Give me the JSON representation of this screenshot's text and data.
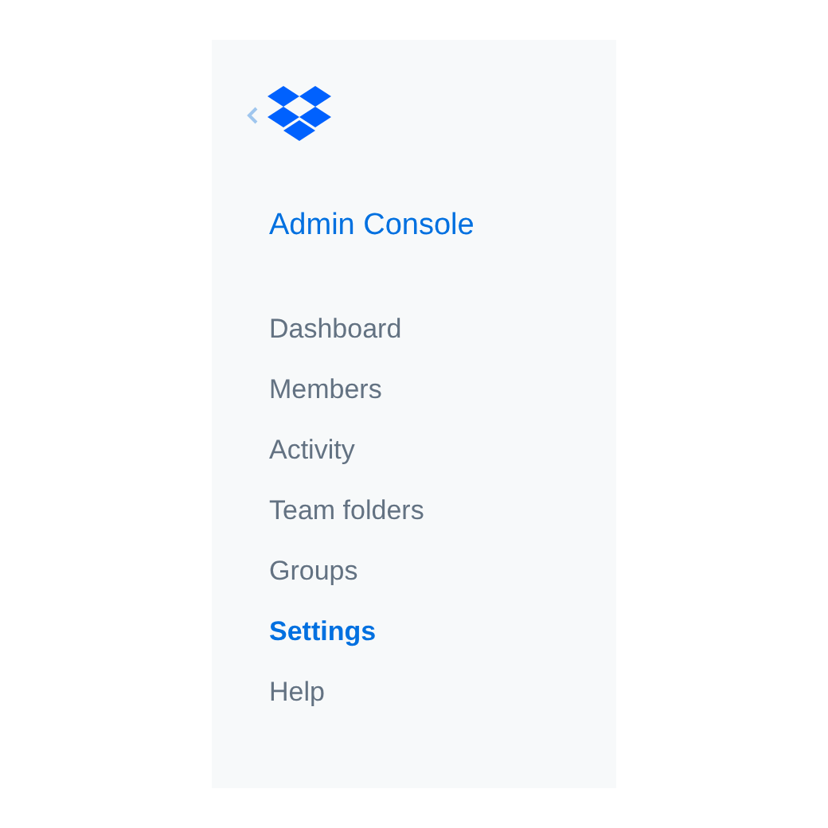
{
  "sidebar": {
    "title": "Admin Console",
    "items": [
      {
        "label": "Dashboard",
        "selected": false
      },
      {
        "label": "Members",
        "selected": false
      },
      {
        "label": "Activity",
        "selected": false
      },
      {
        "label": "Team folders",
        "selected": false
      },
      {
        "label": "Groups",
        "selected": false
      },
      {
        "label": "Settings",
        "selected": true
      },
      {
        "label": "Help",
        "selected": false
      }
    ]
  }
}
